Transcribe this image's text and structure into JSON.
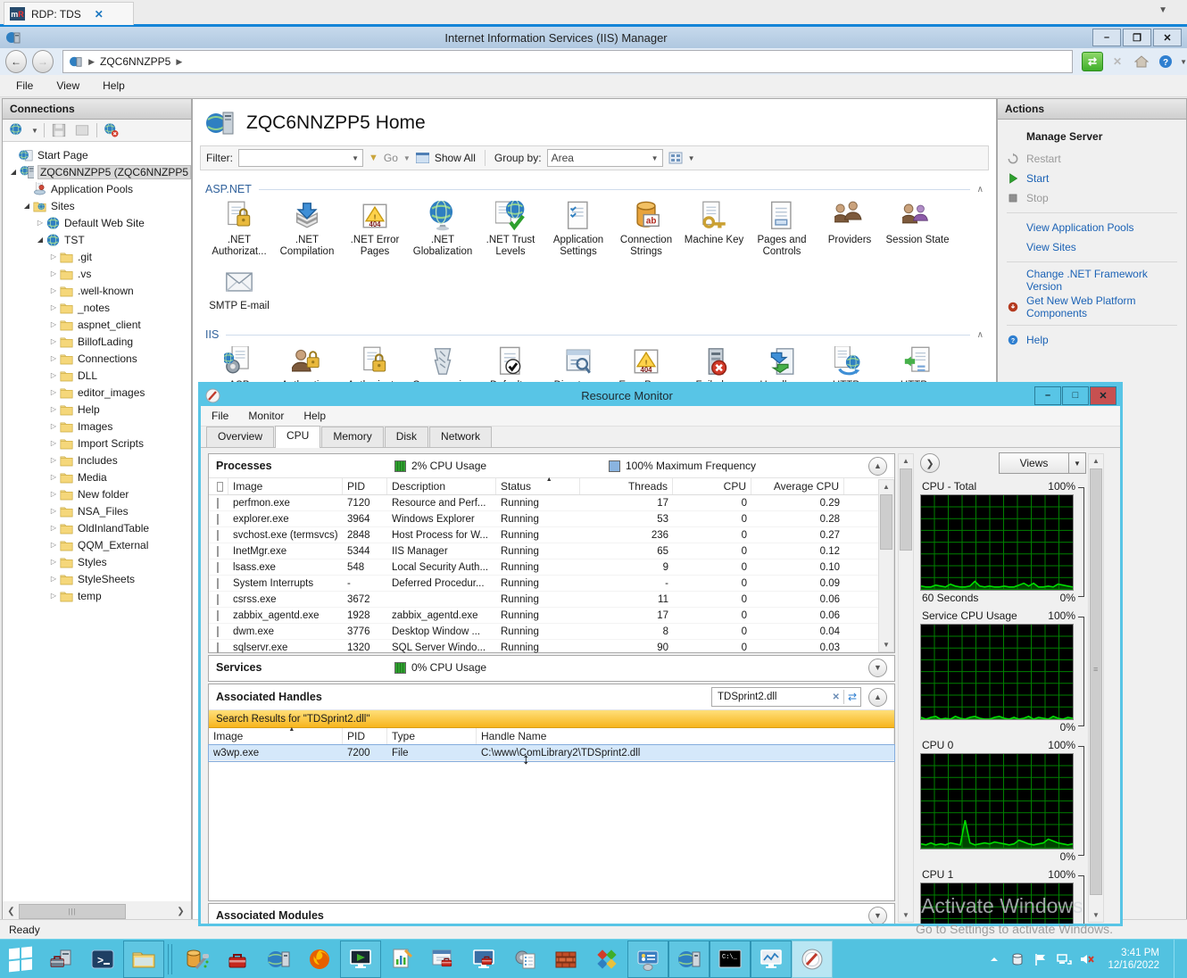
{
  "rdp": {
    "tab_label": "RDP: TDS",
    "tab_icon": "mremoteng-icon",
    "close_glyph": "✕"
  },
  "iis_window": {
    "title": "Internet Information Services (IIS) Manager",
    "breadcrumb": "ZQC6NNZPP5",
    "menu": [
      "File",
      "View",
      "Help"
    ],
    "status": "Ready",
    "connections": {
      "header": "Connections",
      "toolbar_icons": [
        "connect-server-icon",
        "save-connections-icon",
        "rename-icon",
        "remove-connection-icon"
      ],
      "tree": [
        {
          "label": "Start Page",
          "icon": "start-page-icon",
          "depth": 0,
          "exp": ""
        },
        {
          "label": "ZQC6NNZPP5 (ZQC6NNZPP5",
          "icon": "server-icon",
          "depth": 0,
          "exp": "expanded",
          "selected": true
        },
        {
          "label": "Application Pools",
          "icon": "app-pools-icon",
          "depth": 1,
          "exp": ""
        },
        {
          "label": "Sites",
          "icon": "sites-folder-icon",
          "depth": 1,
          "exp": "expanded"
        },
        {
          "label": "Default Web Site",
          "icon": "site-icon",
          "depth": 2,
          "exp": "collapsed"
        },
        {
          "label": "TST",
          "icon": "site-icon",
          "depth": 2,
          "exp": "expanded"
        },
        {
          "label": ".git",
          "icon": "folder-icon",
          "depth": 3,
          "exp": "collapsed"
        },
        {
          "label": ".vs",
          "icon": "folder-icon",
          "depth": 3,
          "exp": "collapsed"
        },
        {
          "label": ".well-known",
          "icon": "folder-icon",
          "depth": 3,
          "exp": "collapsed"
        },
        {
          "label": "_notes",
          "icon": "folder-icon",
          "depth": 3,
          "exp": "collapsed"
        },
        {
          "label": "aspnet_client",
          "icon": "folder-icon",
          "depth": 3,
          "exp": "collapsed"
        },
        {
          "label": "BillofLading",
          "icon": "folder-icon",
          "depth": 3,
          "exp": "collapsed"
        },
        {
          "label": "Connections",
          "icon": "folder-icon",
          "depth": 3,
          "exp": "collapsed"
        },
        {
          "label": "DLL",
          "icon": "folder-icon",
          "depth": 3,
          "exp": "collapsed"
        },
        {
          "label": "editor_images",
          "icon": "folder-icon",
          "depth": 3,
          "exp": "collapsed"
        },
        {
          "label": "Help",
          "icon": "folder-icon",
          "depth": 3,
          "exp": "collapsed"
        },
        {
          "label": "Images",
          "icon": "folder-icon",
          "depth": 3,
          "exp": "collapsed"
        },
        {
          "label": "Import Scripts",
          "icon": "folder-icon",
          "depth": 3,
          "exp": "collapsed"
        },
        {
          "label": "Includes",
          "icon": "folder-icon",
          "depth": 3,
          "exp": "collapsed"
        },
        {
          "label": "Media",
          "icon": "folder-icon",
          "depth": 3,
          "exp": "collapsed"
        },
        {
          "label": "New folder",
          "icon": "folder-icon",
          "depth": 3,
          "exp": "collapsed"
        },
        {
          "label": "NSA_Files",
          "icon": "folder-icon",
          "depth": 3,
          "exp": "collapsed"
        },
        {
          "label": "OldInlandTable",
          "icon": "folder-icon",
          "depth": 3,
          "exp": "collapsed"
        },
        {
          "label": "QQM_External",
          "icon": "folder-icon",
          "depth": 3,
          "exp": "collapsed"
        },
        {
          "label": "Styles",
          "icon": "folder-icon",
          "depth": 3,
          "exp": "collapsed"
        },
        {
          "label": "StyleSheets",
          "icon": "folder-icon",
          "depth": 3,
          "exp": "collapsed"
        },
        {
          "label": "temp",
          "icon": "folder-icon",
          "depth": 3,
          "exp": "collapsed"
        }
      ]
    },
    "home": {
      "title": "ZQC6NNZPP5 Home",
      "filter_label": "Filter:",
      "go_label": "Go",
      "show_all_label": "Show All",
      "group_by_label": "Group by:",
      "group_by_value": "Area",
      "groups": [
        {
          "name": "ASP.NET",
          "items": [
            {
              "label": ".NET Authorizat...",
              "icon": "net-authorization-icon"
            },
            {
              "label": ".NET Compilation",
              "icon": "net-compilation-icon"
            },
            {
              "label": ".NET Error Pages",
              "icon": "net-error-pages-icon"
            },
            {
              "label": ".NET Globalization",
              "icon": "net-globalization-icon"
            },
            {
              "label": ".NET Trust Levels",
              "icon": "net-trust-levels-icon"
            },
            {
              "label": "Application Settings",
              "icon": "application-settings-icon"
            },
            {
              "label": "Connection Strings",
              "icon": "connection-strings-icon"
            },
            {
              "label": "Machine Key",
              "icon": "machine-key-icon"
            },
            {
              "label": "Pages and Controls",
              "icon": "pages-controls-icon"
            },
            {
              "label": "Providers",
              "icon": "providers-icon"
            },
            {
              "label": "Session State",
              "icon": "session-state-icon"
            },
            {
              "label": "SMTP E-mail",
              "icon": "smtp-email-icon"
            }
          ]
        },
        {
          "name": "IIS",
          "items": [
            {
              "label": "ASP",
              "icon": "asp-icon"
            },
            {
              "label": "Authentic...",
              "icon": "authentication-icon"
            },
            {
              "label": "Authorizat...",
              "icon": "authorization-icon"
            },
            {
              "label": "Compression",
              "icon": "compression-icon"
            },
            {
              "label": "Default...",
              "icon": "default-document-icon"
            },
            {
              "label": "Directory...",
              "icon": "directory-browsing-icon"
            },
            {
              "label": "Error Pages",
              "icon": "error-pages-icon"
            },
            {
              "label": "Failed...",
              "icon": "failed-request-icon"
            },
            {
              "label": "Handler...",
              "icon": "handler-mappings-icon"
            },
            {
              "label": "HTTP...",
              "icon": "http-redirect-icon"
            },
            {
              "label": "HTTP...",
              "icon": "http-response-icon"
            }
          ]
        }
      ]
    },
    "actions": {
      "header": "Actions",
      "manage_server": "Manage Server",
      "items": [
        {
          "label": "Restart",
          "icon": "restart-icon",
          "enabled": false
        },
        {
          "label": "Start",
          "icon": "start-play-icon",
          "enabled": true
        },
        {
          "label": "Stop",
          "icon": "stop-icon",
          "enabled": false
        },
        {
          "divider": true
        },
        {
          "label": "View Application Pools",
          "enabled": true
        },
        {
          "label": "View Sites",
          "enabled": true
        },
        {
          "divider": true
        },
        {
          "label": "Change .NET Framework Version",
          "enabled": true
        },
        {
          "label": "Get New Web Platform Components",
          "icon": "web-platform-icon",
          "enabled": true
        },
        {
          "divider": true
        },
        {
          "label": "Help",
          "icon": "help-icon",
          "enabled": true
        }
      ]
    }
  },
  "resmon": {
    "title": "Resource Monitor",
    "menu": [
      "File",
      "Monitor",
      "Help"
    ],
    "tabs": [
      "Overview",
      "CPU",
      "Memory",
      "Disk",
      "Network"
    ],
    "active_tab": "CPU",
    "processes": {
      "header": "Processes",
      "cpu_usage_label": "2% CPU Usage",
      "max_freq_label": "100% Maximum Frequency",
      "columns": [
        "Image",
        "PID",
        "Description",
        "Status",
        "Threads",
        "CPU",
        "Average CPU"
      ],
      "rows": [
        [
          "perfmon.exe",
          "7120",
          "Resource and Perf...",
          "Running",
          "17",
          "0",
          "0.29"
        ],
        [
          "explorer.exe",
          "3964",
          "Windows Explorer",
          "Running",
          "53",
          "0",
          "0.28"
        ],
        [
          "svchost.exe (termsvcs)",
          "2848",
          "Host Process for W...",
          "Running",
          "236",
          "0",
          "0.27"
        ],
        [
          "InetMgr.exe",
          "5344",
          "IIS Manager",
          "Running",
          "65",
          "0",
          "0.12"
        ],
        [
          "lsass.exe",
          "548",
          "Local Security Auth...",
          "Running",
          "9",
          "0",
          "0.10"
        ],
        [
          "System Interrupts",
          "-",
          "Deferred Procedur...",
          "Running",
          "-",
          "0",
          "0.09"
        ],
        [
          "csrss.exe",
          "3672",
          "",
          "Running",
          "11",
          "0",
          "0.06"
        ],
        [
          "zabbix_agentd.exe",
          "1928",
          "zabbix_agentd.exe",
          "Running",
          "17",
          "0",
          "0.06"
        ],
        [
          "dwm.exe",
          "3776",
          "Desktop Window ...",
          "Running",
          "8",
          "0",
          "0.04"
        ],
        [
          "sqlservr.exe",
          "1320",
          "SQL Server Windo...",
          "Running",
          "90",
          "0",
          "0.03"
        ]
      ]
    },
    "services": {
      "header": "Services",
      "cpu_usage_label": "0% CPU Usage"
    },
    "handles": {
      "header": "Associated Handles",
      "search_value": "TDSprint2.dll",
      "results_label": "Search Results for \"TDSprint2.dll\"",
      "columns": [
        "Image",
        "PID",
        "Type",
        "Handle Name"
      ],
      "rows": [
        [
          "w3wp.exe",
          "7200",
          "File",
          "C:\\www\\ComLibrary2\\TDSprint2.dll"
        ]
      ]
    },
    "modules": {
      "header": "Associated Modules"
    },
    "views_label": "Views",
    "graphs": [
      {
        "title": "CPU - Total",
        "top_label": "100%",
        "bottom_left": "60 Seconds",
        "bottom_right": "0%",
        "values": [
          4,
          3,
          3,
          5,
          4,
          3,
          6,
          4,
          3,
          3,
          4,
          9,
          4,
          3,
          4,
          3,
          3,
          4,
          3,
          3,
          5,
          7,
          4,
          7,
          3,
          3,
          4,
          3,
          6,
          5,
          4,
          3
        ]
      },
      {
        "title": "Service CPU Usage",
        "top_label": "100%",
        "bottom_left": "",
        "bottom_right": "0%",
        "values": [
          2,
          0,
          2,
          3,
          0,
          1,
          0,
          3,
          1,
          0,
          2,
          3,
          1,
          0,
          0,
          2,
          3,
          1,
          0,
          2,
          0,
          1,
          3,
          0,
          2,
          1,
          0,
          3,
          1,
          0,
          2,
          1
        ]
      },
      {
        "title": "CPU 0",
        "top_label": "100%",
        "bottom_left": "",
        "bottom_right": "0%",
        "values": [
          5,
          4,
          6,
          4,
          5,
          4,
          6,
          5,
          4,
          30,
          6,
          4,
          5,
          6,
          5,
          7,
          6,
          5,
          4,
          5,
          9,
          7,
          5,
          4,
          5,
          6,
          10,
          8,
          6,
          5,
          4,
          5
        ]
      },
      {
        "title": "CPU 1",
        "top_label": "100%",
        "bottom_left": "",
        "bottom_right": "",
        "values": [
          1,
          1,
          2,
          1,
          1,
          2,
          1,
          1,
          1,
          2,
          1,
          1,
          2,
          1,
          1,
          1,
          2,
          1,
          1,
          2,
          1,
          1,
          1,
          2,
          1,
          1,
          2,
          1,
          1,
          1,
          2,
          1
        ]
      }
    ]
  },
  "watermark": {
    "line1": "Activate Windows",
    "line2": "Go to Settings to activate Windows."
  },
  "taskbar": {
    "time": "3:41 PM",
    "date": "12/16/2022",
    "items": [
      {
        "name": "start-button"
      },
      {
        "name": "server-manager"
      },
      {
        "name": "powershell"
      },
      {
        "name": "file-explorer",
        "boxed": true
      },
      {
        "name": "divider"
      },
      {
        "name": "database-tools"
      },
      {
        "name": "admin-toolbox"
      },
      {
        "name": "iis-manager"
      },
      {
        "name": "firefox"
      },
      {
        "name": "remote-desktop",
        "boxed": true
      },
      {
        "name": "event-viewer"
      },
      {
        "name": "task-scheduler"
      },
      {
        "name": "computer-management"
      },
      {
        "name": "services"
      },
      {
        "name": "firewall"
      },
      {
        "name": "odbc"
      },
      {
        "name": "control-panel",
        "boxed": true
      },
      {
        "name": "iis-server",
        "boxed": true
      },
      {
        "name": "cmd",
        "boxed": true
      },
      {
        "name": "performance-monitor",
        "boxed": true
      },
      {
        "name": "resource-monitor",
        "boxed": true,
        "active": true
      }
    ],
    "tray": [
      "tray-expand-icon",
      "tray-database-icon",
      "tray-flag-icon",
      "tray-network-icon",
      "tray-volume-muted-icon"
    ]
  }
}
